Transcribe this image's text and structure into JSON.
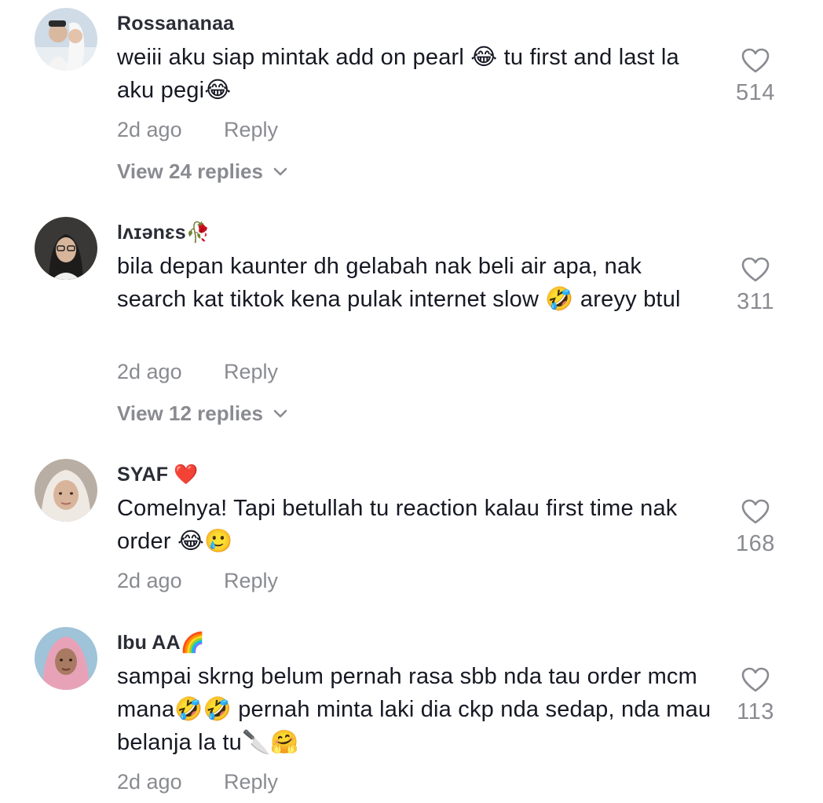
{
  "comments": [
    {
      "username": "Rossananaa",
      "text": "weiii aku siap mintak add on pearl 😂 tu first and last la aku pegi😂",
      "time": "2d ago",
      "reply_label": "Reply",
      "likes": "514",
      "view_replies": "View 24 replies"
    },
    {
      "username": "lʌɪənɛs🥀",
      "text": "bila depan kaunter dh gelabah nak beli air apa, nak search kat tiktok kena pulak internet slow 🤣 areyy btul",
      "time": "2d ago",
      "reply_label": "Reply",
      "likes": "311",
      "view_replies": "View 12 replies"
    },
    {
      "username": "SYAF ❤️",
      "text": "Comelnya! Tapi betullah tu reaction kalau first time nak order 😂🥲",
      "time": "2d ago",
      "reply_label": "Reply",
      "likes": "168"
    },
    {
      "username": "Ibu AA🌈",
      "text": "sampai skrng belum pernah rasa sbb nda tau order mcm mana🤣🤣 pernah minta laki dia ckp nda sedap, nda mau belanja la tu🔪🤗",
      "time": "2d ago",
      "reply_label": "Reply",
      "likes": "113"
    }
  ],
  "colors": {
    "primary_text": "#161823",
    "secondary_text": "#8a8b91",
    "background": "#ffffff"
  },
  "icons": {
    "like": "heart-outline-icon",
    "expand": "chevron-down-icon"
  }
}
